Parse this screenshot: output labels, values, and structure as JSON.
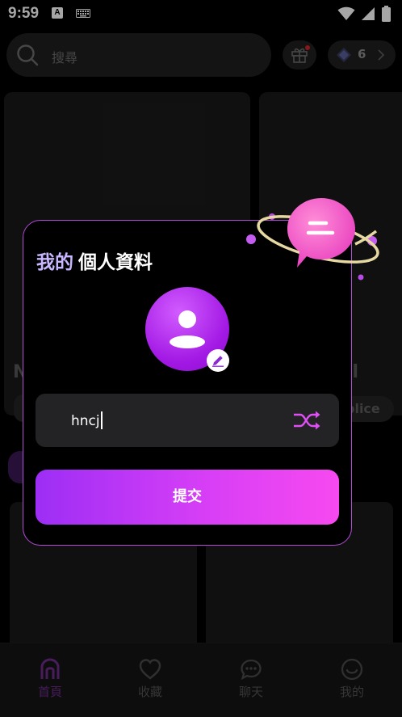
{
  "status_bar": {
    "time": "9:59",
    "notification_letter": "A"
  },
  "header": {
    "search_placeholder": "搜尋",
    "gems_count": "6"
  },
  "background_cards": {
    "left_title_partial": "N",
    "right_title_partial": "ell",
    "right_tag_partial": "plice"
  },
  "dialog": {
    "title_highlight": "我的",
    "title_rest": "個人資料",
    "name_value": "hncj",
    "submit_label": "提交"
  },
  "bottom_nav": {
    "items": [
      {
        "label": "首頁",
        "icon": "home-icon",
        "active": true
      },
      {
        "label": "收藏",
        "icon": "heart-icon",
        "active": false
      },
      {
        "label": "聊天",
        "icon": "chat-icon",
        "active": false
      },
      {
        "label": "我的",
        "icon": "smile-icon",
        "active": false
      }
    ]
  },
  "colors": {
    "accent_purple": "#a218e4",
    "accent_pink": "#f749f0",
    "dialog_border": "#b24bd8",
    "title_highlight": "#c8b7ff",
    "active_nav": "#6d2d8c"
  }
}
